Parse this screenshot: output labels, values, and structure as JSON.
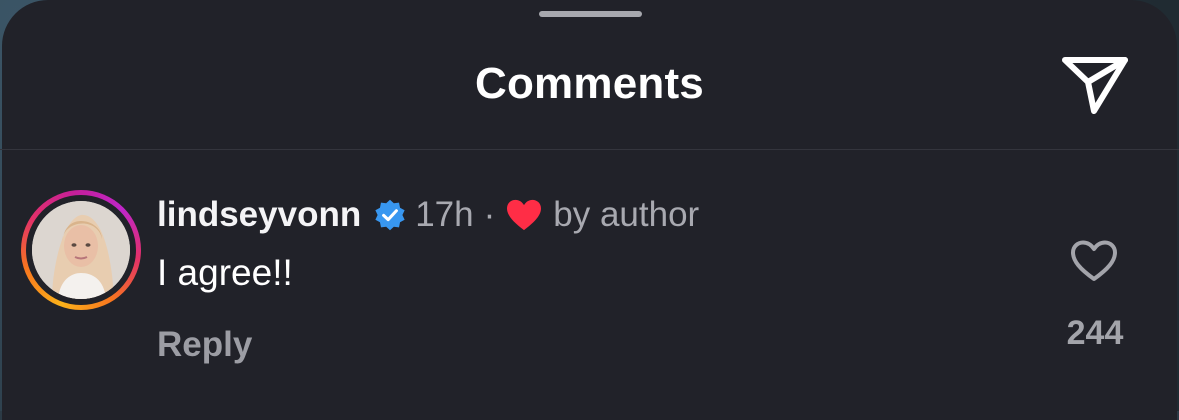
{
  "header": {
    "title": "Comments",
    "send_icon": "paper-plane-icon"
  },
  "comment": {
    "username": "lindseyvonn",
    "verified_icon": "verified-badge-icon",
    "timestamp": "17h",
    "separator": "·",
    "author_like_icon": "red-heart-icon",
    "author_like_label": "by author",
    "text": "I agree!!",
    "reply_label": "Reply",
    "like_icon": "heart-outline-icon",
    "like_count": "244"
  },
  "colors": {
    "background": "#212229",
    "verified_blue": "#3897f0",
    "heart_red": "#ff2d46",
    "story_ring": [
      "#fbb11a",
      "#f7761f",
      "#e2306a",
      "#c026c9"
    ]
  }
}
